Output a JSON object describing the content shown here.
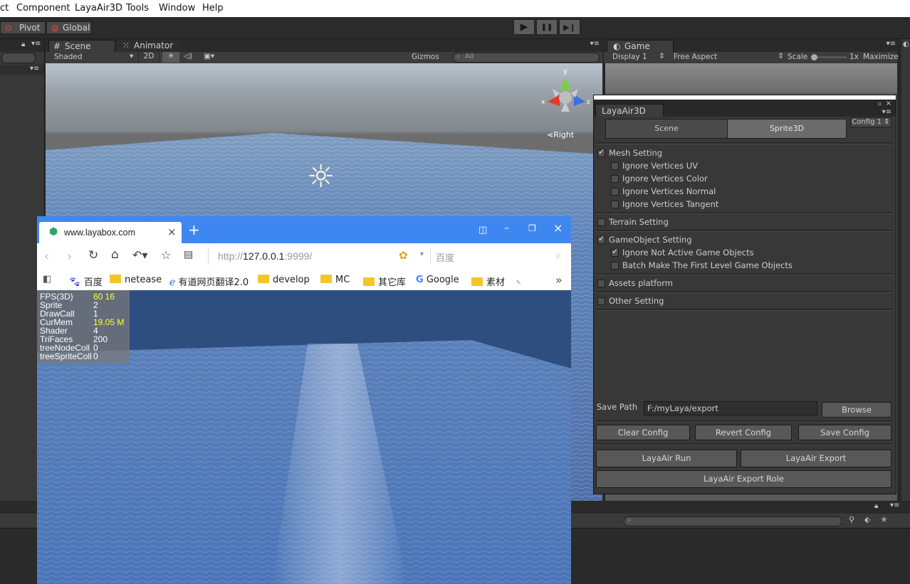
{
  "menubar": {
    "items": [
      "ct",
      "Component",
      "LayaAir3D",
      "Tools",
      "Window",
      "Help"
    ]
  },
  "toolbar": {
    "pivot": "Pivot",
    "global": "Global",
    "play": "▶",
    "pause": "❚❚",
    "step": "▶❙"
  },
  "scene_panel": {
    "tab_scene": "Scene",
    "tab_animator": "Animator",
    "shading": "Shaded",
    "mode_2d": "2D",
    "gizmos": "Gizmos",
    "search_placeholder": "All",
    "axis_y": "y",
    "axis_x": "x",
    "axis_z": "z",
    "right_label": "Right"
  },
  "game_panel": {
    "tab": "Game",
    "display": "Display 1",
    "aspect": "Free Aspect",
    "scale_label": "Scale",
    "scale_value": "1x",
    "maximize": "Maximize"
  },
  "laya_panel": {
    "title": "LayaAir3D",
    "tabs": [
      "Scene",
      "Sprite3D"
    ],
    "active_tab": "Sprite3D",
    "config": "Config 1",
    "mesh_setting": "Mesh Setting",
    "mesh_options": [
      "Ignore Vertices UV",
      "Ignore Vertices Color",
      "Ignore Vertices Normal",
      "Ignore Vertices Tangent"
    ],
    "terrain_setting": "Terrain Setting",
    "gameobject_setting": "GameObject Setting",
    "gameobject_options": [
      "Ignore Not Active Game Objects",
      "Batch Make The First Level Game Objects"
    ],
    "assets_platform": "Assets platform",
    "other_setting": "Other Setting",
    "save_path_label": "Save Path",
    "save_path_value": "F:/myLaya/export",
    "browse": "Browse",
    "clear_config": "Clear Config",
    "revert_config": "Revert Config",
    "save_config": "Save Config",
    "run": "LayaAir Run",
    "export": "LayaAir Export",
    "export_role": "LayaAir Export Role"
  },
  "browser": {
    "tab_title": "www.layabox.com",
    "new_tab": "+",
    "url_prefix": "http://",
    "url_host": "127.0.0.1",
    "url_suffix": ":9999/",
    "search_placeholder": "百度",
    "bookmarks": [
      "百度",
      "netease",
      "有道网页翻译2.0",
      "develop",
      "MC",
      "其它库",
      "Google",
      "素材"
    ],
    "stats": [
      {
        "label": "FPS(3D)",
        "value": "60 16",
        "highlight": true
      },
      {
        "label": "Sprite",
        "value": "2",
        "highlight": false
      },
      {
        "label": "DrawCall",
        "value": "1",
        "highlight": false
      },
      {
        "label": "CurMem",
        "value": "19.05 M",
        "highlight": true
      },
      {
        "label": "Shader",
        "value": "4",
        "highlight": false
      },
      {
        "label": "TriFaces",
        "value": "200",
        "highlight": false
      },
      {
        "label": "treeNodeColl",
        "value": "0",
        "highlight": false
      },
      {
        "label": "treeSpriteColl",
        "value": "0",
        "highlight": false
      }
    ]
  }
}
